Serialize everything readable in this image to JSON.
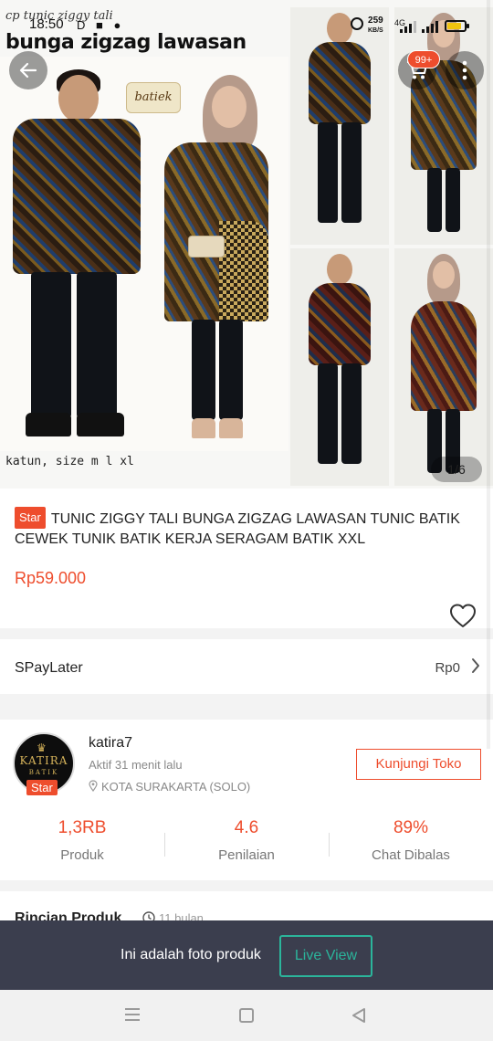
{
  "status_bar": {
    "time": "18:50",
    "icons_left": "D ■ ●",
    "speed_value": "259",
    "speed_unit": "KB/S",
    "network": "4G"
  },
  "hero": {
    "handwritten_text": "cp tunic ziggy tali",
    "title": "bunga zigzag lawasan",
    "logo_text": "batiek",
    "caption": "katun, size m l xl",
    "image_counter": "1/6"
  },
  "header": {
    "cart_badge": "99+",
    "back_icon": "arrow-left-icon",
    "cart_icon": "cart-icon",
    "more_icon": "more-vertical-icon"
  },
  "product": {
    "badge": "Star",
    "title": "TUNIC ZIGGY TALI BUNGA ZIGZAG LAWASAN TUNIC BATIK CEWEK TUNIK BATIK KERJA SERAGAM BATIK XXL",
    "price": "Rp59.000",
    "favorite_icon": "heart-icon"
  },
  "spaylater": {
    "label": "SPayLater",
    "amount": "Rp0"
  },
  "shop": {
    "avatar_text": "KATIRA",
    "avatar_subtext": "BATIK",
    "badge": "Star",
    "name": "katira7",
    "active": "Aktif 31 menit lalu",
    "location": "KOTA SURAKARTA (SOLO)",
    "visit_button": "Kunjungi Toko",
    "stats": [
      {
        "value": "1,3RB",
        "label": "Produk"
      },
      {
        "value": "4.6",
        "label": "Penilaian"
      },
      {
        "value": "89%",
        "label": "Chat Dibalas"
      }
    ]
  },
  "details": {
    "label": "Rincian Produk",
    "time": "11 bulan"
  },
  "photo_bar": {
    "text": "Ini adalah foto produk",
    "button": "Live View"
  },
  "colors": {
    "accent": "#ee4d2d",
    "live_view": "#2bb59b",
    "overlay_bar": "#3b3e4e"
  }
}
